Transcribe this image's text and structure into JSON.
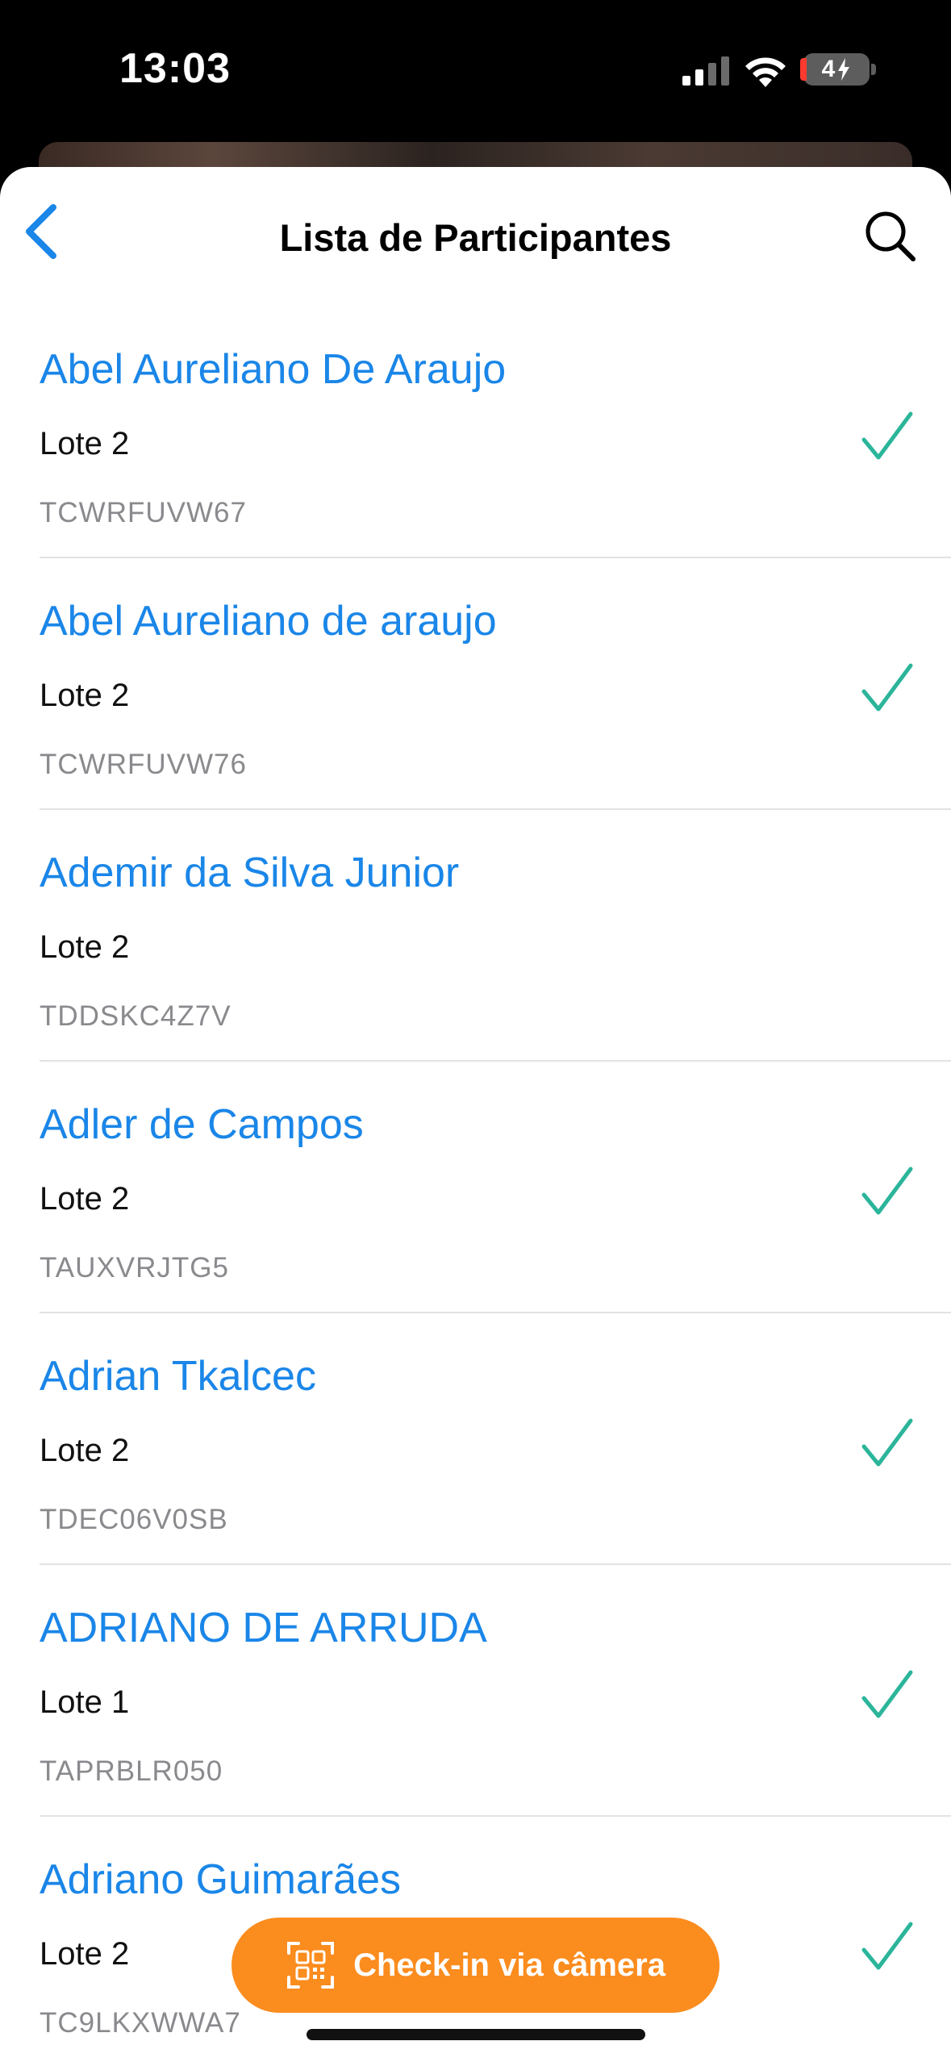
{
  "status_bar": {
    "time": "13:03",
    "battery": "4"
  },
  "header": {
    "title": "Lista de Participantes",
    "back_icon": "chevron-left-icon",
    "search_icon": "search-icon"
  },
  "colors": {
    "accent": "#1a86e8",
    "check": "#2bb59a",
    "cta": "#fb8c1e"
  },
  "participants": [
    {
      "name": "Abel Aureliano De Araujo",
      "lote": "Lote 2",
      "code": "TCWRFUVW67",
      "checked_in": true
    },
    {
      "name": "Abel Aureliano de araujo",
      "lote": "Lote 2",
      "code": "TCWRFUVW76",
      "checked_in": true
    },
    {
      "name": "Ademir da Silva Junior",
      "lote": "Lote 2",
      "code": "TDDSKC4Z7V",
      "checked_in": false
    },
    {
      "name": "Adler de Campos",
      "lote": "Lote 2",
      "code": "TAUXVRJTG5",
      "checked_in": true
    },
    {
      "name": "Adrian Tkalcec",
      "lote": "Lote 2",
      "code": "TDEC06V0SB",
      "checked_in": true
    },
    {
      "name": "ADRIANO DE ARRUDA",
      "lote": "Lote 1",
      "code": "TAPRBLR050",
      "checked_in": true
    },
    {
      "name": "Adriano Guimarães",
      "lote": "Lote 2",
      "code": "TC9LKXWWA7",
      "checked_in": true
    }
  ],
  "cta": {
    "label": "Check-in via câmera",
    "icon": "qr-code-icon"
  }
}
